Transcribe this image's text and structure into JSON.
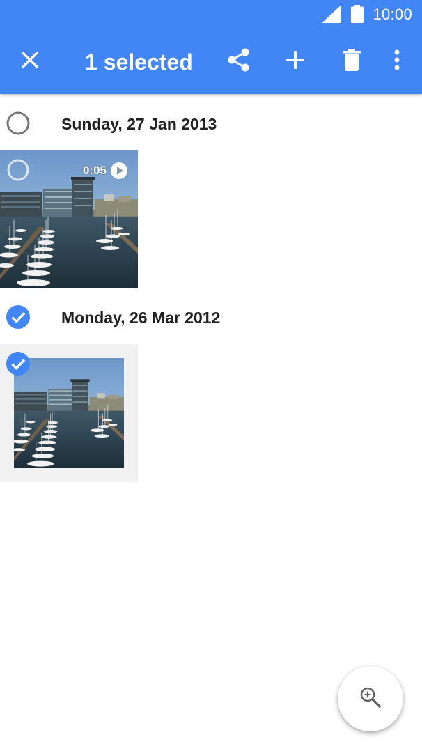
{
  "status_bar": {
    "time": "10:00",
    "signal_icon": "signal-icon",
    "battery_icon": "battery-icon"
  },
  "app_bar": {
    "title": "1 selected",
    "close_icon": "close-icon",
    "actions": [
      "share-icon",
      "add-icon",
      "delete-icon",
      "more-vert-icon"
    ]
  },
  "sections": [
    {
      "date": "Sunday, 27 Jan 2013",
      "selected": false,
      "items": [
        {
          "type": "video",
          "duration": "0:05",
          "selected": false
        }
      ]
    },
    {
      "date": "Monday, 26 Mar 2012",
      "selected": true,
      "items": [
        {
          "type": "photo",
          "selected": true
        }
      ]
    }
  ],
  "fab": {
    "icon": "zoom-in-icon"
  },
  "colors": {
    "primary": "#4285f4",
    "text": "#212121",
    "check_unselected": "#757575"
  }
}
